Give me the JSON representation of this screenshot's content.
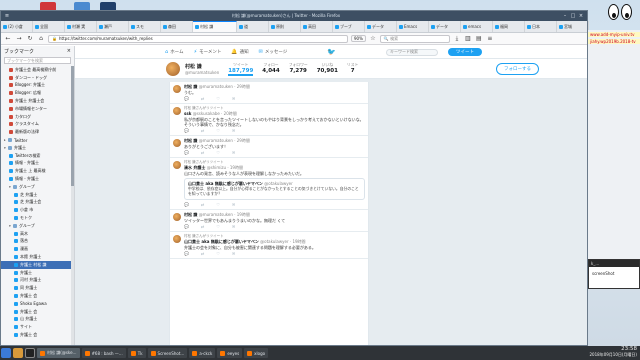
{
  "window": {
    "title": "村松 謙(@muramatsuken)さん | Twitter - Mozilla Firefox"
  },
  "tabs": [
    {
      "label": "(2) 小倉"
    },
    {
      "label": "全国"
    },
    {
      "label": "村瀬 実"
    },
    {
      "label": "瀬戸"
    },
    {
      "label": "スモ"
    },
    {
      "label": "森田"
    },
    {
      "label": "村松 謙",
      "active": true
    },
    {
      "label": "道"
    },
    {
      "label": "原則"
    },
    {
      "label": "高田"
    },
    {
      "label": "ブーブ"
    },
    {
      "label": "データ"
    },
    {
      "label": "Emacs"
    },
    {
      "label": "データ"
    },
    {
      "label": "emacs"
    },
    {
      "label": "福岡"
    },
    {
      "label": "日本"
    },
    {
      "label": "宮城"
    }
  ],
  "nav": {
    "url": "https://twitter.com/muramatsuken/with_replies",
    "zoom": "90%",
    "search_placeholder": "検索"
  },
  "sidebar": {
    "title": "ブックマーク",
    "close": "×",
    "search_placeholder": "ブックマークを検索",
    "items": [
      {
        "label": "弁護士会 最高検察庁前",
        "type": "page",
        "indent": 1
      },
      {
        "label": "ダンコー・ドッグ",
        "type": "page",
        "indent": 1
      },
      {
        "label": "Blogger: 弁護士",
        "type": "page",
        "indent": 1
      },
      {
        "label": "Blogger: 広報",
        "type": "page",
        "indent": 1
      },
      {
        "label": "弁護士 弁護士会",
        "type": "page",
        "indent": 1
      },
      {
        "label": "市場情報センター",
        "type": "page",
        "indent": 1
      },
      {
        "label": "カタログ",
        "type": "page",
        "indent": 1
      },
      {
        "label": "クラスタイム",
        "type": "page",
        "indent": 1
      },
      {
        "label": "最新版の法律",
        "type": "page",
        "indent": 1
      },
      {
        "label": "Twitter",
        "type": "folder",
        "indent": 0,
        "tri": "▸"
      },
      {
        "label": "弁護士",
        "type": "folder",
        "indent": 0,
        "tri": "▾"
      },
      {
        "label": "Twitterの検索",
        "type": "tw",
        "indent": 1
      },
      {
        "label": "情報 - 弁護士",
        "type": "tw",
        "indent": 1
      },
      {
        "label": "弁護士 上 最高検",
        "type": "tw",
        "indent": 1
      },
      {
        "label": "情報 - 弁護士",
        "type": "tw",
        "indent": 1
      },
      {
        "label": "グループ",
        "type": "folder",
        "indent": 1,
        "tri": "▾"
      },
      {
        "label": "芝 弁護士",
        "type": "tw",
        "indent": 2
      },
      {
        "label": "芝 弁護士会",
        "type": "tw",
        "indent": 2
      },
      {
        "label": "小倉 市",
        "type": "tw",
        "indent": 2
      },
      {
        "label": "モトク",
        "type": "tw",
        "indent": 2
      },
      {
        "label": "グループ",
        "type": "folder",
        "indent": 1,
        "tri": "▾"
      },
      {
        "label": "高木",
        "type": "tw",
        "indent": 2
      },
      {
        "label": "落合",
        "type": "tw",
        "indent": 2
      },
      {
        "label": "漫画",
        "type": "tw",
        "indent": 2
      },
      {
        "label": "本館 弁護士",
        "type": "tw",
        "indent": 2
      },
      {
        "label": "弁護士 村松 謙",
        "type": "tw",
        "indent": 2,
        "selected": true
      },
      {
        "label": "弁護士",
        "type": "tw",
        "indent": 2
      },
      {
        "label": "河村 弁護士",
        "type": "tw",
        "indent": 2
      },
      {
        "label": "同 弁護士",
        "type": "tw",
        "indent": 2
      },
      {
        "label": "弁護士 会",
        "type": "tw",
        "indent": 2
      },
      {
        "label": "Shoko Egawa",
        "type": "tw",
        "indent": 2
      },
      {
        "label": "弁護士 会",
        "type": "tw",
        "indent": 2
      },
      {
        "label": "山 弁護士",
        "type": "tw",
        "indent": 2
      },
      {
        "label": "サイト",
        "type": "tw",
        "indent": 2
      },
      {
        "label": "弁護士 会",
        "type": "tw",
        "indent": 2
      }
    ]
  },
  "twitter": {
    "nav": [
      {
        "icon": "⌂",
        "label": "ホーム"
      },
      {
        "icon": "⚡",
        "label": "モーメント"
      },
      {
        "icon": "🔔",
        "label": "通知"
      },
      {
        "icon": "✉",
        "label": "メッセージ"
      }
    ],
    "search_placeholder": "キーワード検索",
    "tweet_button": "ツイート",
    "profile": {
      "name": "村松 謙",
      "handle": "@muramatsuken",
      "follow_button": "フォローする"
    },
    "stats": [
      {
        "label": "ツイート",
        "value": "187,799",
        "active": true
      },
      {
        "label": "フォロー",
        "value": "4,044"
      },
      {
        "label": "フォロワー",
        "value": "7,279"
      },
      {
        "label": "いいね",
        "value": "70,901"
      },
      {
        "label": "リスト",
        "value": "7"
      }
    ],
    "tweets": [
      {
        "ctx": "",
        "name": "村松 謙",
        "meta": "@muramatsuken · 29時間",
        "text": "うむ。"
      },
      {
        "ctx": "村松 謙さんがリツイート",
        "name": "ssk",
        "meta": "@sskusakabe · 20時間",
        "text": "私が京都駅のことを言ったツイートしないのもやはり背景をしっかり考えておかないといけないな。そういう事情で、かなり残念だ。"
      },
      {
        "ctx": "",
        "name": "村松 謙",
        "meta": "@muramatsuken · 29時間",
        "text": "ありがとうございます！"
      },
      {
        "ctx": "村松 謙さんがリツイート",
        "name": "清水 弁護士",
        "meta": "@shimizu · 19時間",
        "text": "山口さんの発言、読みそうな人が表現を理解しなかったみたいだ。",
        "quote": {
          "name": "山口貴士 aka 無駄に感じが悪いヤマベン",
          "handle": "@otakulawyer",
          "text": "中学校は、依存症以上。自分が心得ることがなかったとすることの気づきとけていない。自分のことを知っていますか？"
        }
      },
      {
        "ctx": "",
        "name": "村松 謙",
        "meta": "@muramatsuken · 19時間",
        "text": "ツイッター世界でもあんまりうまいのかな。無理だ くて"
      },
      {
        "ctx": "村松 謙さんがリツイート",
        "name": "山口貴士 aka 無駄に感じが悪いヤマベン",
        "meta": "@otakulawyer · 19時間",
        "text": "弁護士の会を対象に、自分も被害に関連する問題を理解する必要がある。"
      }
    ]
  },
  "rightpanel": {
    "lines": [
      "www.add-myip-univ.tv",
      "jiahy.wp2019b.2018-tv"
    ]
  },
  "screenwin": {
    "title": "k_…",
    "body": "screenShot"
  },
  "taskbar": {
    "tasks": [
      {
        "label": "村松 謙(@ske…",
        "active": true
      },
      {
        "label": "#68 : bash —…"
      },
      {
        "label": "Tk"
      },
      {
        "label": "ScreenShot…"
      },
      {
        "label": "a-ckck"
      },
      {
        "label": "eeyes"
      },
      {
        "label": "xlogo"
      }
    ],
    "clock_time": "23:58",
    "clock_date": "2018年09月10日(月曜日)"
  }
}
